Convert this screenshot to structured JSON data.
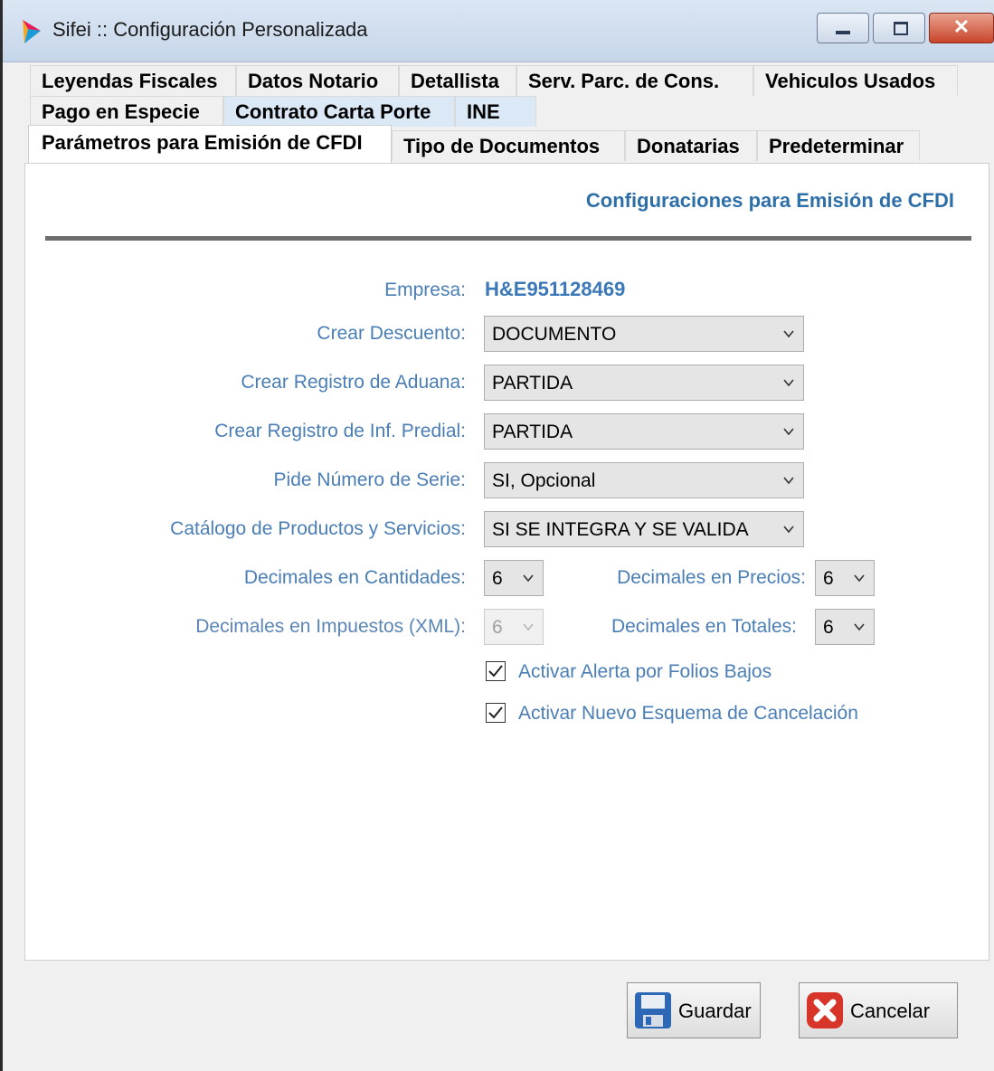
{
  "window": {
    "title": "Sifei :: Configuración Personalizada"
  },
  "tabs": {
    "row1": [
      "Leyendas Fiscales",
      "Datos Notario",
      "Detallista",
      "Serv. Parc. de Cons.",
      "Vehiculos Usados"
    ],
    "row2": [
      "Pago en Especie",
      "Contrato Carta Porte",
      "INE"
    ],
    "row3": [
      "Parámetros para Emisión de CFDI",
      "Tipo de Documentos",
      "Donatarias",
      "Predeterminar"
    ]
  },
  "panel": {
    "section_title": "Configuraciones para Emisión de CFDI",
    "empresa_label": "Empresa:",
    "empresa_value": "H&E951128469",
    "crear_descuento_label": "Crear Descuento:",
    "crear_descuento_value": "DOCUMENTO",
    "registro_aduana_label": "Crear Registro de Aduana:",
    "registro_aduana_value": "PARTIDA",
    "registro_predial_label": "Crear Registro de Inf. Predial:",
    "registro_predial_value": "PARTIDA",
    "numero_serie_label": "Pide Número de Serie:",
    "numero_serie_value": "SI, Opcional",
    "catalogo_label": "Catálogo de Productos y Servicios:",
    "catalogo_value": "SI SE INTEGRA Y SE VALIDA",
    "dec_cantidades_label": "Decimales en Cantidades:",
    "dec_cantidades_value": "6",
    "dec_precios_label": "Decimales en Precios:",
    "dec_precios_value": "6",
    "dec_impuestos_label": "Decimales en Impuestos (XML):",
    "dec_impuestos_value": "6",
    "dec_totales_label": "Decimales en Totales:",
    "dec_totales_value": "6",
    "alerta_folios_label": "Activar Alerta por Folios Bajos",
    "alerta_folios_checked": true,
    "nuevo_esquema_label": "Activar Nuevo Esquema de Cancelación",
    "nuevo_esquema_checked": true
  },
  "buttons": {
    "save_label": "Guardar",
    "cancel_label": "Cancelar"
  }
}
